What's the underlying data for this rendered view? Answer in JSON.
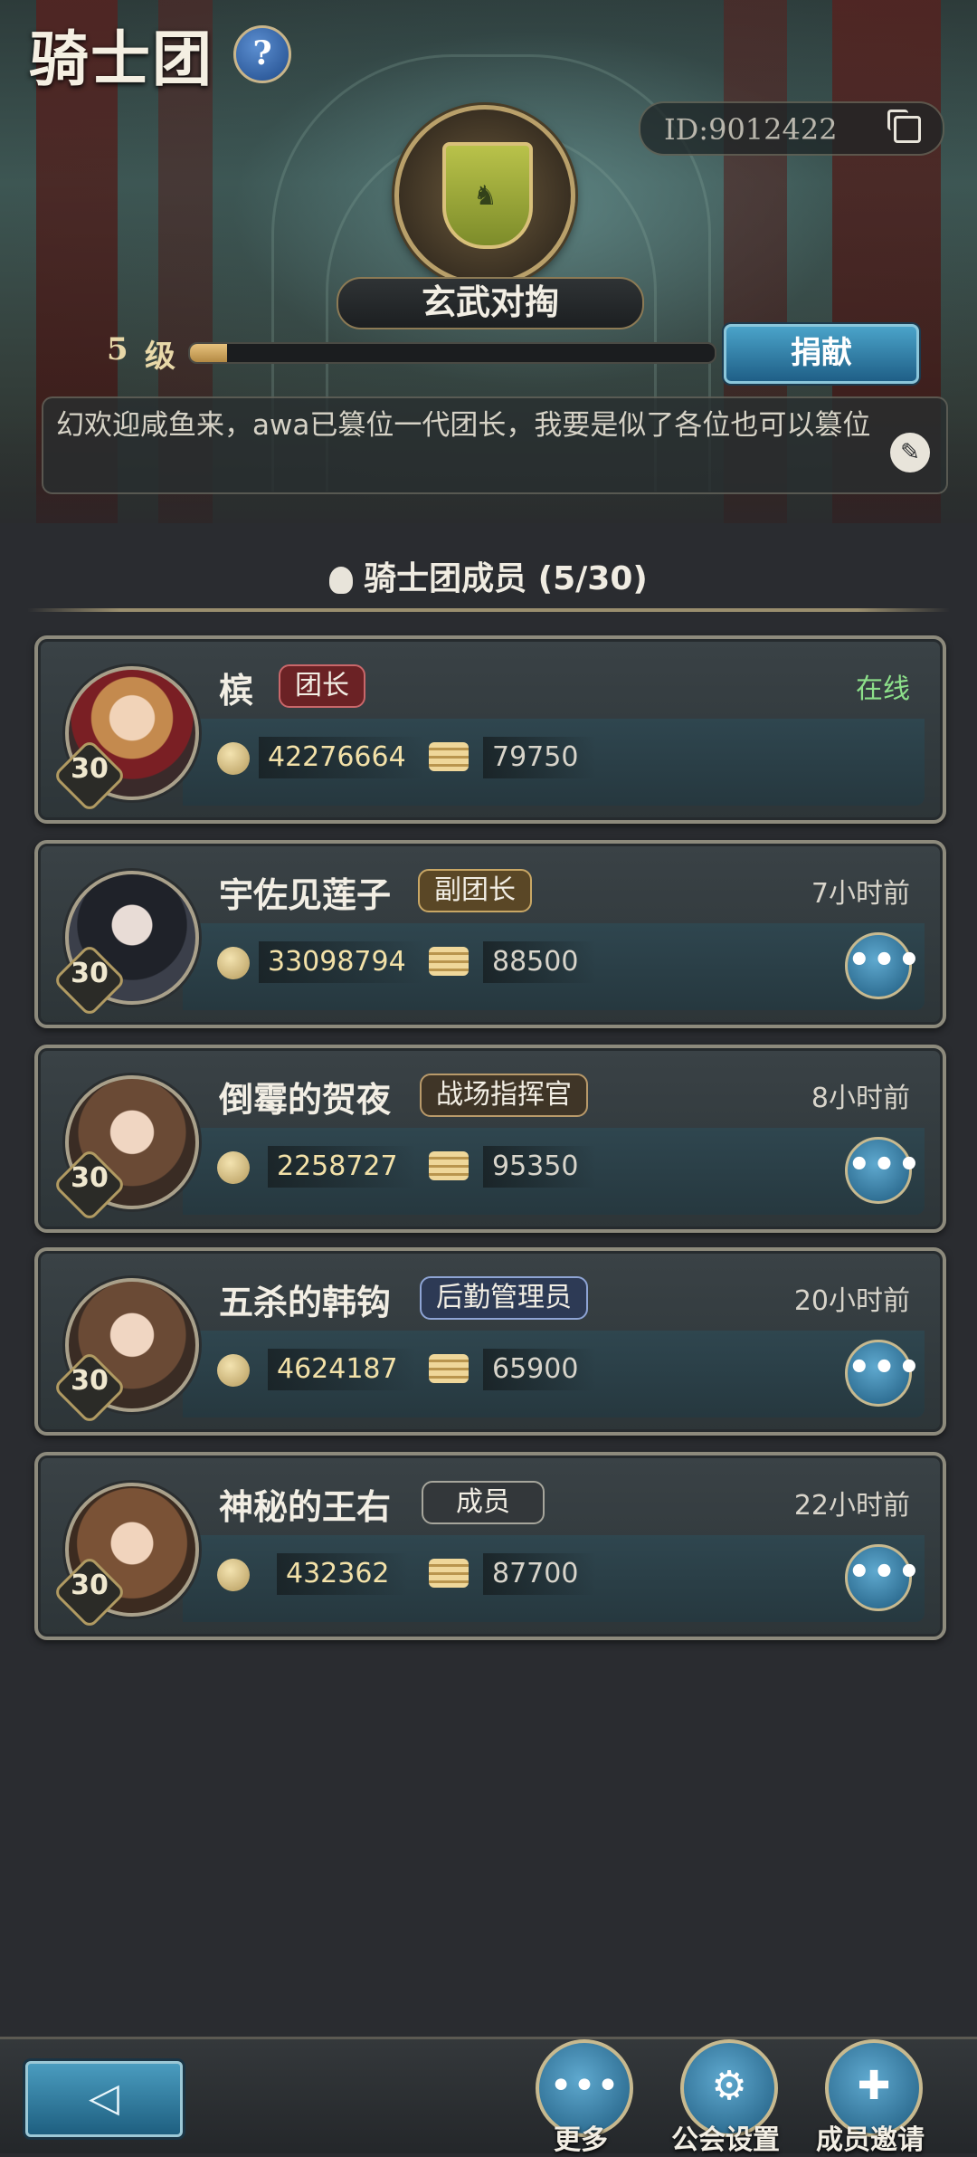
{
  "header": {
    "title": "骑士团",
    "help_icon": "?",
    "guild_id": "ID:9012422",
    "guild_name": "玄武对掏",
    "level_number": "5",
    "level_unit": "级",
    "level_progress": 0.07,
    "donate_label": "捐献",
    "notice": "幻欢迎咸鱼来，awa已篡位一代团长，我要是似了各位也可以篡位"
  },
  "members_section": {
    "title": "骑士团成员 (5/30)"
  },
  "members": [
    {
      "name": "槟",
      "role": "团长",
      "status": "在线",
      "power": "42276664",
      "coins": "79750",
      "level": "30"
    },
    {
      "name": "宇佐见莲子",
      "role": "副团长",
      "status": "7小时前",
      "power": "33098794",
      "coins": "88500",
      "level": "30"
    },
    {
      "name": "倒霉的贺夜",
      "role": "战场指挥官",
      "status": "8小时前",
      "power": "2258727",
      "coins": "95350",
      "level": "30"
    },
    {
      "name": "五杀的韩钩",
      "role": "后勤管理员",
      "status": "20小时前",
      "power": "4624187",
      "coins": "65900",
      "level": "30"
    },
    {
      "name": "神秘的王右",
      "role": "成员",
      "status": "22小时前",
      "power": "432362",
      "coins": "87700",
      "level": "30"
    }
  ],
  "more_button_glyph": "•••",
  "bottom_nav": {
    "more_label": "更多",
    "settings_label": "公会设置",
    "invite_label": "成员邀请"
  },
  "colors": {
    "online": "#8de08a",
    "accent_blue": "#2f7fa6",
    "gold": "#b9a06a"
  }
}
